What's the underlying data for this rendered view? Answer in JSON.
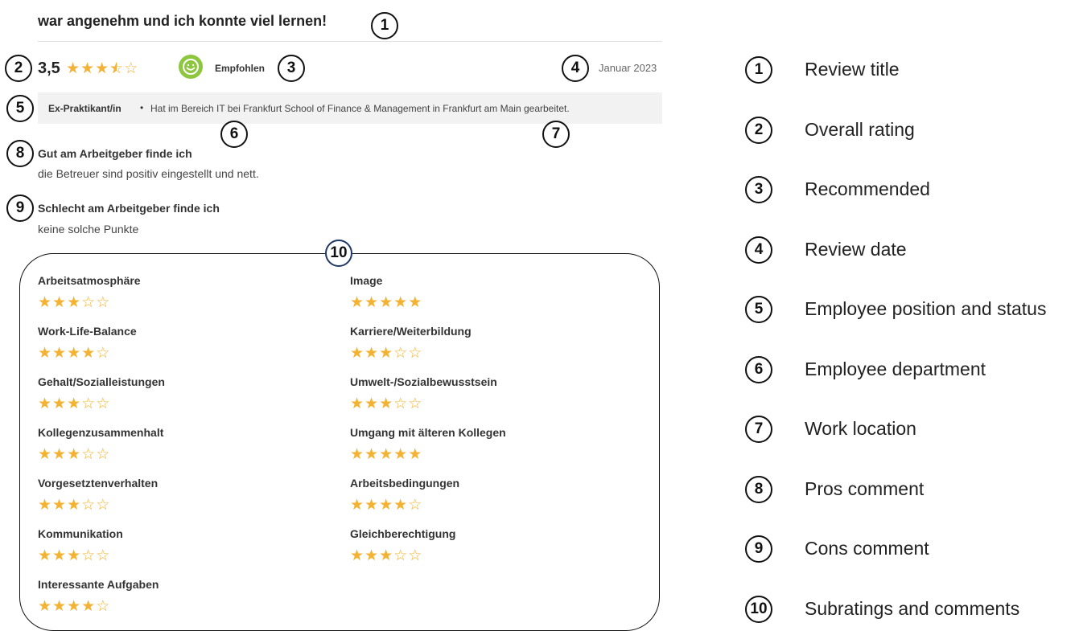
{
  "review": {
    "title": "war angenehm und ich konnte viel lernen!",
    "overall_rating": "3,5",
    "overall_stars": 3.5,
    "recommended_label": "Empfohlen",
    "date": "Januar 2023",
    "position": "Ex-Praktikant/in",
    "bullet": "•",
    "department_text": "Hat im Bereich IT bei Frankfurt School of Finance & Management in Frankfurt am Main gearbeitet.",
    "pros_heading": "Gut am Arbeitgeber finde ich",
    "pros_text": "die Betreuer sind positiv eingestellt und nett.",
    "cons_heading": "Schlecht am Arbeitgeber finde ich",
    "cons_text": "keine solche Punkte"
  },
  "subratings": [
    {
      "label": "Arbeitsatmosphäre",
      "stars": 3
    },
    {
      "label": "Image",
      "stars": 5
    },
    {
      "label": "Work-Life-Balance",
      "stars": 4
    },
    {
      "label": "Karriere/Weiterbildung",
      "stars": 3
    },
    {
      "label": "Gehalt/Sozialleistungen",
      "stars": 3
    },
    {
      "label": "Umwelt-/Sozialbewusstsein",
      "stars": 3
    },
    {
      "label": "Kollegenzusammenhalt",
      "stars": 3
    },
    {
      "label": "Umgang mit älteren Kollegen",
      "stars": 5
    },
    {
      "label": "Vorgesetztenverhalten",
      "stars": 3
    },
    {
      "label": "Arbeitsbedingungen",
      "stars": 4
    },
    {
      "label": "Kommunikation",
      "stars": 3
    },
    {
      "label": "Gleichberechtigung",
      "stars": 3
    },
    {
      "label": "Interessante Aufgaben",
      "stars": 4
    }
  ],
  "badges": [
    "1",
    "2",
    "3",
    "4",
    "5",
    "6",
    "7",
    "8",
    "9",
    "10"
  ],
  "legend": [
    {
      "num": "1",
      "text": "Review title"
    },
    {
      "num": "2",
      "text": "Overall rating"
    },
    {
      "num": "3",
      "text": "Recommended"
    },
    {
      "num": "4",
      "text": "Review date"
    },
    {
      "num": "5",
      "text": "Employee position and status"
    },
    {
      "num": "6",
      "text": "Employee department"
    },
    {
      "num": "7",
      "text": "Work location"
    },
    {
      "num": "8",
      "text": "Pros comment"
    },
    {
      "num": "9",
      "text": "Cons comment"
    },
    {
      "num": "10",
      "text": "Subratings and comments"
    }
  ],
  "colors": {
    "star": "#f3b234",
    "recommend_green": "#8dc63f",
    "meta_bg": "#f2f2f2",
    "badge_blue": "#1f3864"
  }
}
